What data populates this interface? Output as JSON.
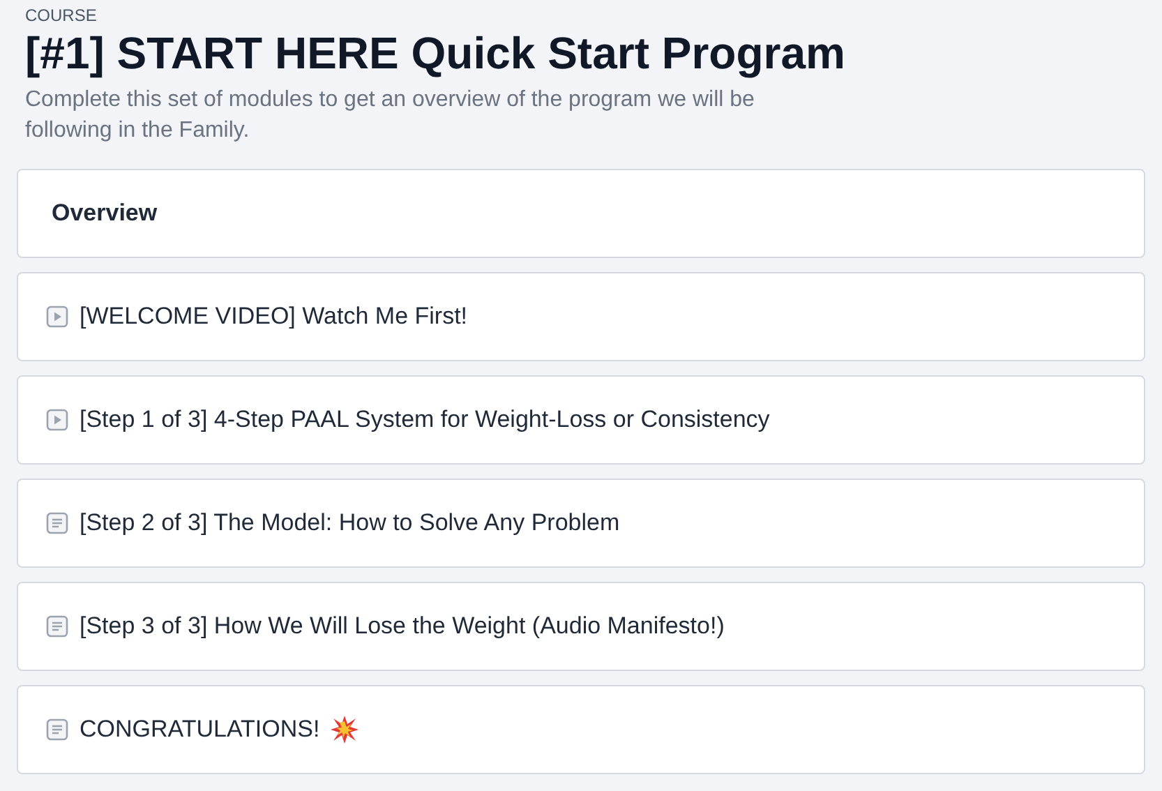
{
  "eyebrow": "COURSE",
  "title": "[#1] START HERE Quick Start Program",
  "description": "Complete this set of modules to get an overview of the program we will be following in the Family.",
  "overview": {
    "label": "Overview"
  },
  "lessons": [
    {
      "kind": "video",
      "title": "[WELCOME VIDEO] Watch Me First!"
    },
    {
      "kind": "video",
      "title": "[Step 1 of 3] 4-Step PAAL System for Weight-Loss or Consistency"
    },
    {
      "kind": "text",
      "title": "[Step 2 of 3] The Model: How to Solve Any Problem"
    },
    {
      "kind": "text",
      "title": "[Step 3 of 3] How We Will Lose the Weight (Audio Manifesto!)"
    },
    {
      "kind": "text",
      "title": "CONGRATULATIONS!",
      "trailing_icon": true
    }
  ]
}
